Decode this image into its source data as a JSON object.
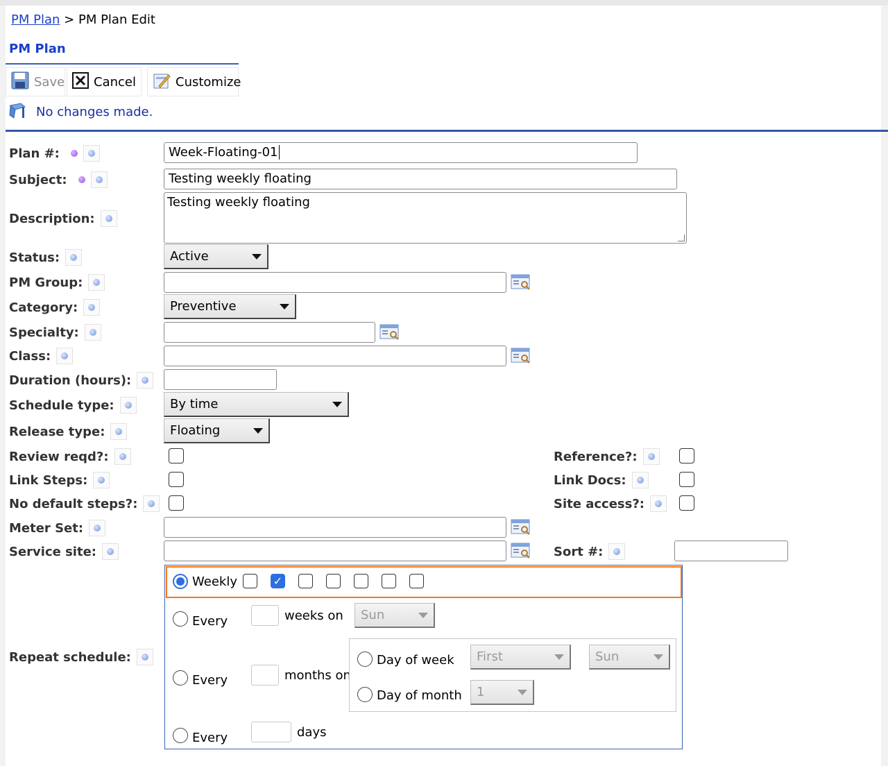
{
  "breadcrumb": {
    "link": "PM Plan",
    "separator": ">",
    "current": "PM Plan Edit"
  },
  "section_title": "PM Plan",
  "toolbar": {
    "save": "Save",
    "cancel": "Cancel",
    "customize": "Customize"
  },
  "status_message": "No changes made.",
  "labels": {
    "plan_no": "Plan #:",
    "subject": "Subject:",
    "description": "Description:",
    "status": "Status:",
    "pm_group": "PM Group:",
    "category": "Category:",
    "specialty": "Specialty:",
    "class": "Class:",
    "duration": "Duration (hours):",
    "schedule_type": "Schedule type:",
    "release_type": "Release type:",
    "review_reqd": "Review reqd?:",
    "link_steps": "Link Steps:",
    "no_default_steps": "No default steps?:",
    "meter_set": "Meter Set:",
    "service_site": "Service site:",
    "reference": "Reference?:",
    "link_docs": "Link Docs:",
    "site_access": "Site access?:",
    "sort_no": "Sort #:",
    "repeat_schedule": "Repeat schedule:"
  },
  "values": {
    "plan_no": "Week-Floating-01",
    "subject": "Testing weekly floating",
    "description": "Testing weekly floating",
    "status": "Active",
    "pm_group": "",
    "category": "Preventive",
    "specialty": "",
    "class": "",
    "duration": "",
    "schedule_type": "By time",
    "release_type": "Floating",
    "meter_set": "",
    "service_site": "",
    "sort_no": "",
    "review_reqd": false,
    "link_steps": false,
    "no_default_steps": false,
    "reference": false,
    "link_docs": false,
    "site_access": false
  },
  "repeat": {
    "weekly_label": "Weekly",
    "weekly_selected": true,
    "days": "days",
    "every_label": "Every",
    "weeks_on": "weeks on",
    "weeks_on_day": "Sun",
    "months_on": "months on",
    "day_of_week": "Day of week",
    "day_of_week_ordinal": "First",
    "day_of_week_day": "Sun",
    "day_of_month": "Day of month",
    "day_of_month_value": "1"
  },
  "colors": {
    "link": "#1a3fc9",
    "accent_rule": "#3059a8",
    "highlight": "#f07a1a",
    "checked": "#2d6fe0"
  }
}
